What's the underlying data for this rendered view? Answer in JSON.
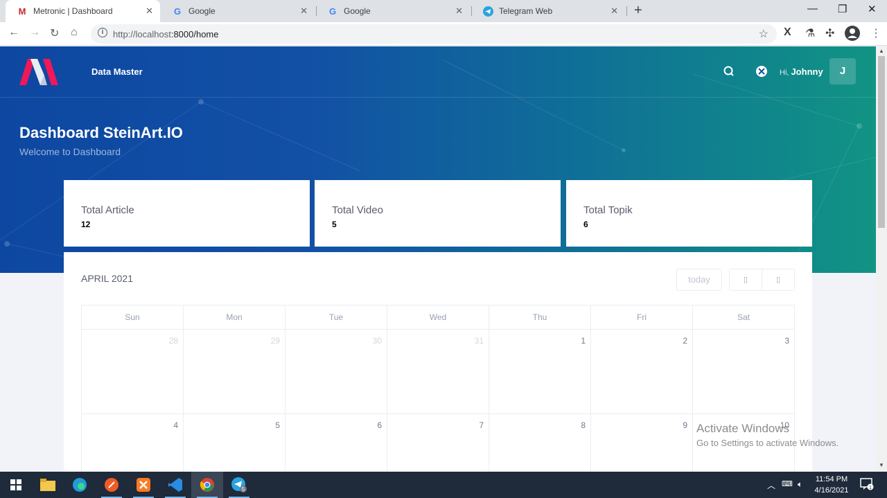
{
  "browser": {
    "tabs": [
      {
        "title": "Metronic | Dashboard",
        "icon": "metronic-favicon",
        "active": true
      },
      {
        "title": "Google",
        "icon": "google-favicon",
        "active": false
      },
      {
        "title": "Google",
        "icon": "google-favicon",
        "active": false
      },
      {
        "title": "Telegram Web",
        "icon": "telegram-favicon",
        "active": false
      }
    ],
    "url_host": "http://localhost",
    "url_rest": ":8000/home"
  },
  "header": {
    "brand": "Data Master",
    "greeting": "Hi,",
    "user_name": "Johnny",
    "avatar_letter": "J"
  },
  "hero": {
    "title": "Dashboard SteinArt.IO",
    "subtitle": "Welcome to Dashboard"
  },
  "stats": [
    {
      "label": "Total Article",
      "value": "12"
    },
    {
      "label": "Total Video",
      "value": "5"
    },
    {
      "label": "Total Topik",
      "value": "6"
    }
  ],
  "calendar": {
    "title": "APRIL 2021",
    "today_label": "today",
    "days_of_week": [
      "Sun",
      "Mon",
      "Tue",
      "Wed",
      "Thu",
      "Fri",
      "Sat"
    ],
    "weeks": [
      [
        {
          "d": "28",
          "other": true
        },
        {
          "d": "29",
          "other": true
        },
        {
          "d": "30",
          "other": true
        },
        {
          "d": "31",
          "other": true
        },
        {
          "d": "1",
          "other": false
        },
        {
          "d": "2",
          "other": false
        },
        {
          "d": "3",
          "other": false
        }
      ],
      [
        {
          "d": "4",
          "other": false
        },
        {
          "d": "5",
          "other": false
        },
        {
          "d": "6",
          "other": false
        },
        {
          "d": "7",
          "other": false
        },
        {
          "d": "8",
          "other": false
        },
        {
          "d": "9",
          "other": false
        },
        {
          "d": "10",
          "other": false
        }
      ]
    ]
  },
  "watermark": {
    "line1": "Activate Windows",
    "line2": "Go to Settings to activate Windows."
  },
  "taskbar": {
    "time": "11:54 PM",
    "date": "4/16/2021",
    "telegram_badge": "5",
    "notification_count": "1"
  },
  "colors": {
    "hero_start": "#0d47a1",
    "hero_end": "#119484",
    "logo_accent": "#f0175a"
  }
}
